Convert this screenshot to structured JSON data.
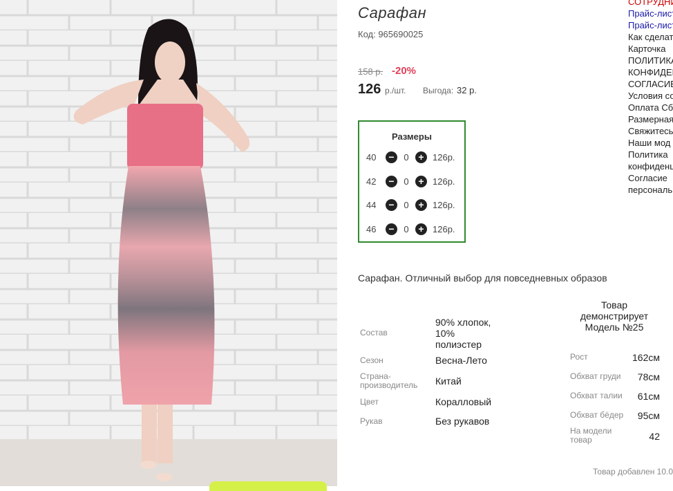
{
  "product": {
    "title": "Сарафан",
    "code": "Код: 965690025",
    "old_price": "158 р.",
    "discount": "-20%",
    "price": "126",
    "price_unit": "р./шт.",
    "profit_label": "Выгода:",
    "profit_value": "32 р.",
    "description": "Сарафан. Отличный выбор для повседневных образов",
    "added": "Товар добавлен 10.0"
  },
  "sizes": {
    "title": "Размеры",
    "rows": [
      {
        "size": "40",
        "qty": "0",
        "price": "126р."
      },
      {
        "size": "42",
        "qty": "0",
        "price": "126р."
      },
      {
        "size": "44",
        "qty": "0",
        "price": "126р."
      },
      {
        "size": "46",
        "qty": "0",
        "price": "126р."
      }
    ]
  },
  "properties": [
    {
      "label": "Состав",
      "value": "90% хлопок, 10% полиэстер"
    },
    {
      "label": "Сезон",
      "value": "Весна-Лето"
    },
    {
      "label": "Страна-производитель",
      "value": "Китай"
    },
    {
      "label": "Цвет",
      "value": "Коралловый"
    },
    {
      "label": "Рукав",
      "value": "Без рукавов"
    }
  ],
  "model": {
    "title": "Товар демонстрирует Модель №25",
    "params": [
      {
        "label": "Рост",
        "value": "162см"
      },
      {
        "label": "Обхват груди",
        "value": "78см"
      },
      {
        "label": "Обхват талии",
        "value": "61см"
      },
      {
        "label": "Обхват бёдер",
        "value": "95см"
      },
      {
        "label": "На модели товар",
        "value": "42"
      }
    ]
  },
  "right_menu": [
    {
      "label": "СОТРУДНИ",
      "color": "#c00000"
    },
    {
      "label": "Прайс-лист",
      "color": "#1a1aa6"
    },
    {
      "label": "Прайс-лист",
      "color": "#1a1aa6"
    },
    {
      "label": "Как сделать"
    },
    {
      "label": "Карточка"
    },
    {
      "label": "ПОЛИТИКА"
    },
    {
      "label": "КОНФИДЕН"
    },
    {
      "label": "СОГЛАСИЕ"
    },
    {
      "label": "Условия со"
    },
    {
      "label": "Оплата Сб"
    },
    {
      "label": "Размерная"
    },
    {
      "label": "Свяжитесь"
    },
    {
      "label": "Наши мод"
    },
    {
      "label": "Политика"
    },
    {
      "label": "конфиденц"
    },
    {
      "label": "Согласие"
    },
    {
      "label": "персональ"
    }
  ],
  "icons": {
    "minus": "minus-circle-icon",
    "plus": "plus-circle-icon"
  },
  "colors": {
    "discount": "#e0415b",
    "sizes_border": "#2f8a2f",
    "button_green": "#d6f04a"
  }
}
